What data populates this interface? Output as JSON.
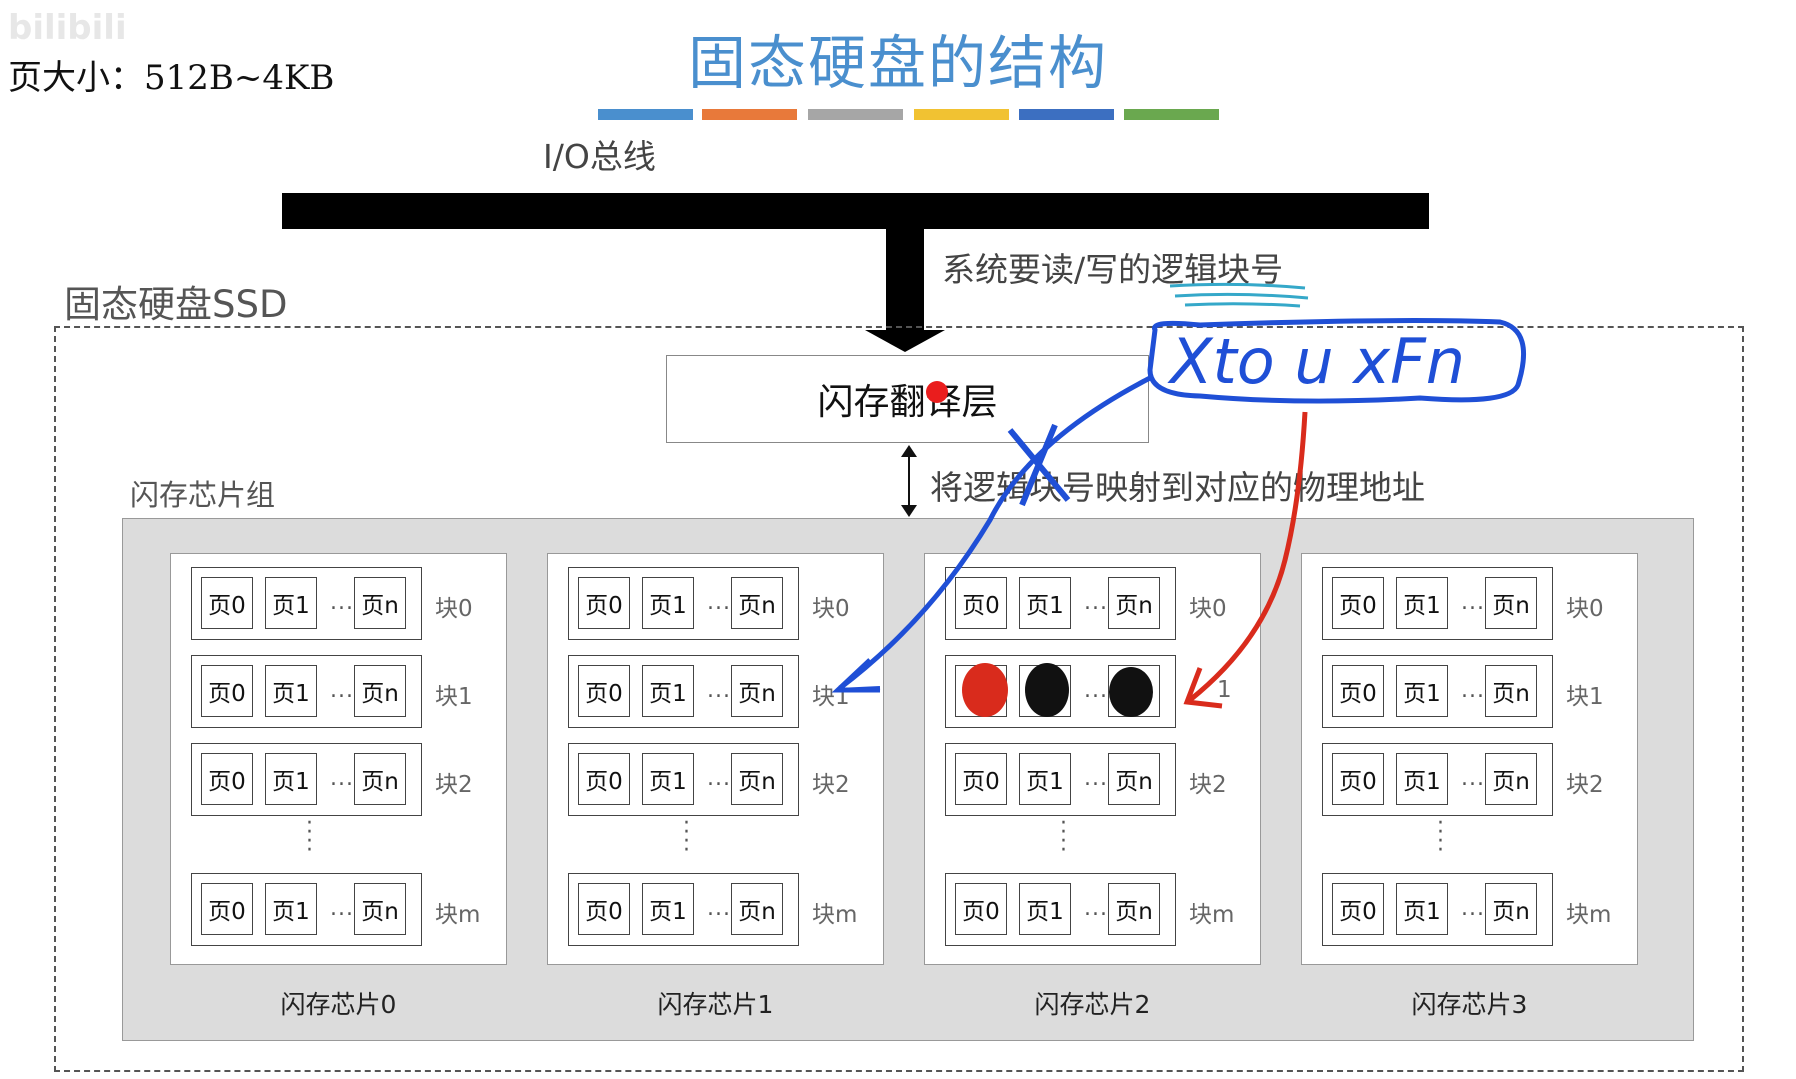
{
  "watermark": "bilibili",
  "page_size_note": "页大小：512B~4KB",
  "title": "固态硬盘的结构",
  "color_bars": [
    "#4a8fce",
    "#e8793a",
    "#a6a6a6",
    "#f1c232",
    "#3c6fc1",
    "#6aa84f"
  ],
  "io_bus_label": "I/O总线",
  "read_write_label": "系统要读/写的逻辑块号",
  "ssd_label": "固态硬盘SSD",
  "ftl_label": "闪存翻译层",
  "mapping_label": "将逻辑块号映射到对应的物理地址",
  "chip_group_label": "闪存芯片组",
  "annotation_handwritten": "Xto u xFn",
  "chips": [
    {
      "label": "闪存芯片0",
      "blocks": [
        {
          "label": "块0",
          "pages": [
            "页0",
            "页1",
            "页n"
          ]
        },
        {
          "label": "块1",
          "pages": [
            "页0",
            "页1",
            "页n"
          ]
        },
        {
          "label": "块2",
          "pages": [
            "页0",
            "页1",
            "页n"
          ]
        },
        {
          "label": "块m",
          "pages": [
            "页0",
            "页1",
            "页n"
          ]
        }
      ]
    },
    {
      "label": "闪存芯片1",
      "blocks": [
        {
          "label": "块0",
          "pages": [
            "页0",
            "页1",
            "页n"
          ]
        },
        {
          "label": "块1",
          "pages": [
            "页0",
            "页1",
            "页n"
          ]
        },
        {
          "label": "块2",
          "pages": [
            "页0",
            "页1",
            "页n"
          ]
        },
        {
          "label": "块m",
          "pages": [
            "页0",
            "页1",
            "页n"
          ]
        }
      ]
    },
    {
      "label": "闪存芯片2",
      "blocks": [
        {
          "label": "块0",
          "pages": [
            "页0",
            "页1",
            "页n"
          ]
        },
        {
          "label": "1",
          "pages": [
            "",
            "",
            ""
          ]
        },
        {
          "label": "块2",
          "pages": [
            "页0",
            "页1",
            "页n"
          ]
        },
        {
          "label": "块m",
          "pages": [
            "页0",
            "页1",
            "页n"
          ]
        }
      ]
    },
    {
      "label": "闪存芯片3",
      "blocks": [
        {
          "label": "块0",
          "pages": [
            "页0",
            "页1",
            "页n"
          ]
        },
        {
          "label": "块1",
          "pages": [
            "页0",
            "页1",
            "页n"
          ]
        },
        {
          "label": "块2",
          "pages": [
            "页0",
            "页1",
            "页n"
          ]
        },
        {
          "label": "块m",
          "pages": [
            "页0",
            "页1",
            "页n"
          ]
        }
      ]
    }
  ],
  "ellipsis": "...",
  "vertical_ellipsis": "⋮"
}
